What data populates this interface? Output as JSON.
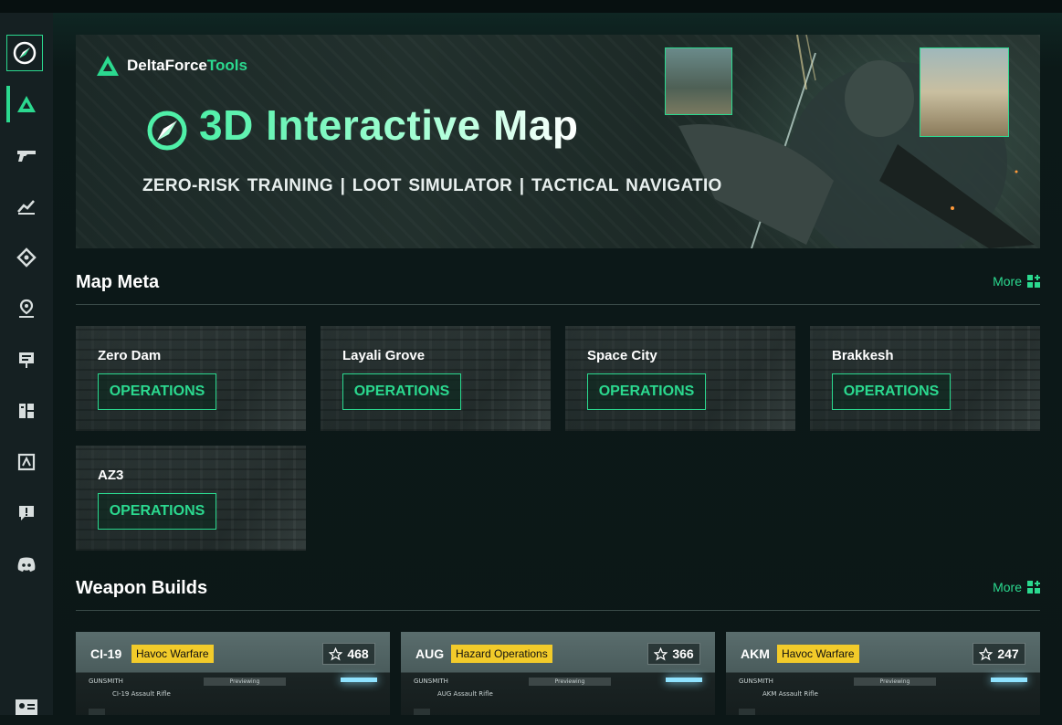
{
  "banner": {
    "brand_part1": "DeltaForce",
    "brand_part2": "Tools",
    "title": "3D Interactive Map",
    "subtitle": "ZERO-RISK TRAINING  |  LOOT SIMULATOR  |  TACTICAL NAVIGATIO"
  },
  "sidebar": {
    "items": [
      {
        "icon": "delta-icon",
        "active": true
      },
      {
        "icon": "gun-icon"
      },
      {
        "icon": "chart-icon"
      },
      {
        "icon": "diamond-target-icon"
      },
      {
        "icon": "map-pin-icon"
      },
      {
        "icon": "board-icon"
      },
      {
        "icon": "grid-icon"
      },
      {
        "icon": "cards-icon"
      },
      {
        "icon": "alert-icon"
      },
      {
        "icon": "discord-icon"
      },
      {
        "icon": "profile-card-icon"
      }
    ]
  },
  "map_meta": {
    "title": "Map Meta",
    "more_label": "More",
    "cards": [
      {
        "name": "Zero Dam",
        "button": "OPERATIONS"
      },
      {
        "name": "Layali Grove",
        "button": "OPERATIONS"
      },
      {
        "name": "Space City",
        "button": "OPERATIONS"
      },
      {
        "name": "Brakkesh",
        "button": "OPERATIONS"
      },
      {
        "name": "AZ3",
        "button": "OPERATIONS"
      }
    ]
  },
  "weapon_builds": {
    "title": "Weapon Builds",
    "more_label": "More",
    "cards": [
      {
        "name": "CI-19",
        "tag": "Havoc Warfare",
        "favorites": "468",
        "model": "CI-19 Assault Rifle"
      },
      {
        "name": "AUG",
        "tag": "Hazard Operations",
        "favorites": "366",
        "model": "AUG Assault Rifle"
      },
      {
        "name": "AKM",
        "tag": "Havoc Warfare",
        "favorites": "247",
        "model": "AKM Assault Rifle"
      }
    ],
    "gunsmith_label": "GUNSMITH",
    "preview_label": "Previewing"
  },
  "colors": {
    "accent": "#2bd98f",
    "tag": "#f2cb2a",
    "background": "#0c1717"
  }
}
